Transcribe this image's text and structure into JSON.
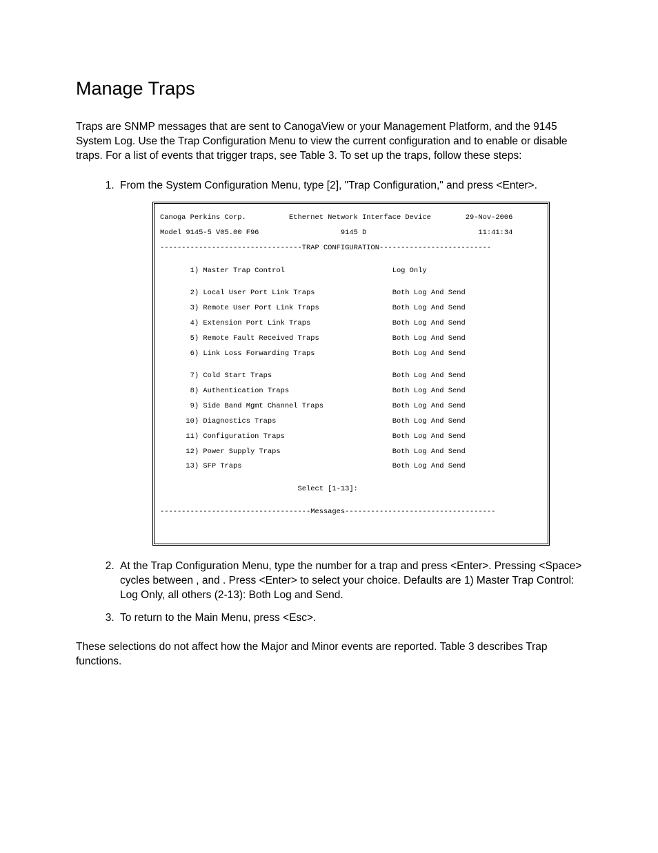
{
  "title": "Manage Traps",
  "intro": "Traps are SNMP messages that are sent to CanogaView or your Management Platform, and the 9145 System Log.  Use the Trap Configuration Menu to view the current configuration and to enable or disable traps.  For a list of events that trigger traps, see Table 3.  To set up the traps, follow these steps:",
  "steps": {
    "s1": "From the System Configuration Menu, type [2], \"Trap Configuration,\" and press <Enter>.",
    "s2": "At the Trap Configuration Menu, type the number for a trap and press <Enter>.  Pressing <Space> cycles between                    ,                                         and               .  Press <Enter> to select your choice.  Defaults are 1) Master Trap Control: Log Only, all others (2-13): Both Log and Send.",
    "s3": "To return to the Main Menu, press <Esc>."
  },
  "closing": "These selections do not affect how the Major and Minor events are reported.  Table 3 describes Trap functions.",
  "terminal": {
    "l01": "Canoga Perkins Corp.          Ethernet Network Interface Device        29-Nov-2006",
    "l02": "Model 9145-5 V05.00 F96                   9145 D                          11:41:34",
    "l03": "---------------------------------TRAP CONFIGURATION--------------------------",
    "l04": "",
    "l05": "       1) Master Trap Control                         Log Only",
    "l06": "",
    "l07": "       2) Local User Port Link Traps                  Both Log And Send",
    "l08": "       3) Remote User Port Link Traps                 Both Log And Send",
    "l09": "       4) Extension Port Link Traps                   Both Log And Send",
    "l10": "       5) Remote Fault Received Traps                 Both Log And Send",
    "l11": "       6) Link Loss Forwarding Traps                  Both Log And Send",
    "l12": "",
    "l13": "       7) Cold Start Traps                            Both Log And Send",
    "l14": "       8) Authentication Traps                        Both Log And Send",
    "l15": "       9) Side Band Mgmt Channel Traps                Both Log And Send",
    "l16": "      10) Diagnostics Traps                           Both Log And Send",
    "l17": "      11) Configuration Traps                         Both Log And Send",
    "l18": "      12) Power Supply Traps                          Both Log And Send",
    "l19": "      13) SFP Traps                                   Both Log And Send",
    "l20": "",
    "l21": "                                Select [1-13]:",
    "l22": "",
    "l23": "-----------------------------------Messages-----------------------------------"
  }
}
